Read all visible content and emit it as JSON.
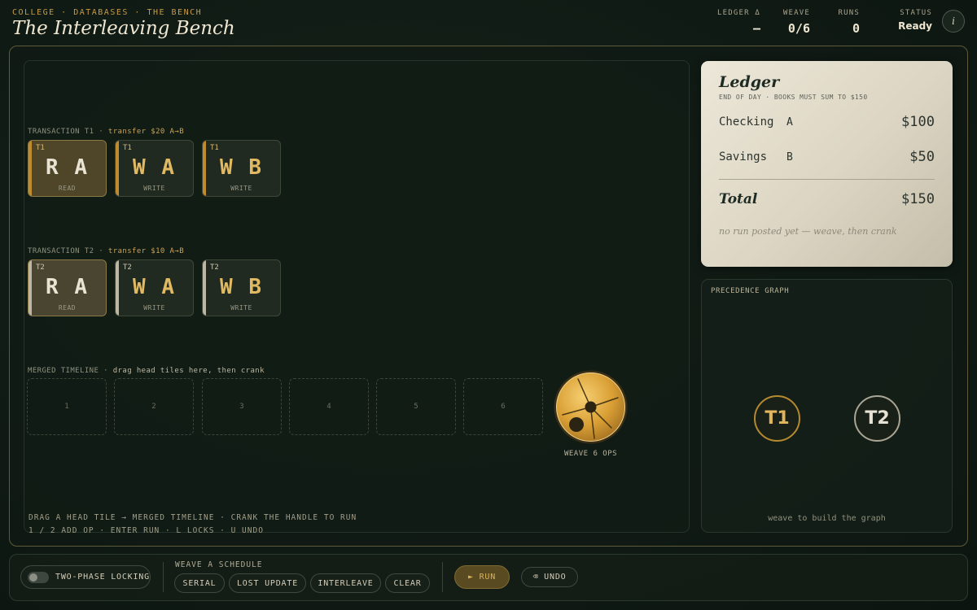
{
  "header": {
    "breadcrumb": "COLLEGE · DATABASES · THE BENCH",
    "title": "The Interleaving Bench",
    "stats": [
      {
        "label": "LEDGER Δ",
        "value": "—"
      },
      {
        "label": "WEAVE",
        "value": "0/6"
      },
      {
        "label": "RUNS",
        "value": "0"
      },
      {
        "label": "STATUS",
        "value": "Ready"
      }
    ],
    "help_icon_glyph": "i"
  },
  "bench": {
    "t1": {
      "label_prefix": "TRANSACTION T1  ·  ",
      "label_detail": "transfer $20  A→B",
      "tiles": [
        {
          "tag": "T1",
          "op": "R A",
          "kind": "READ"
        },
        {
          "tag": "T1",
          "op": "W A",
          "kind": "WRITE"
        },
        {
          "tag": "T1",
          "op": "W B",
          "kind": "WRITE"
        }
      ]
    },
    "t2": {
      "label_prefix": "TRANSACTION T2  ·  ",
      "label_detail": "transfer $10  A→B",
      "tiles": [
        {
          "tag": "T2",
          "op": "R A",
          "kind": "READ"
        },
        {
          "tag": "T2",
          "op": "W A",
          "kind": "WRITE"
        },
        {
          "tag": "T2",
          "op": "W B",
          "kind": "WRITE"
        }
      ]
    },
    "timeline": {
      "label_prefix": "MERGED TIMELINE  ·  ",
      "label_detail": "drag head tiles here, then crank",
      "slots": [
        "1",
        "2",
        "3",
        "4",
        "5",
        "6"
      ]
    },
    "crank_label": "WEAVE 6 OPS",
    "hint_line1": "DRAG A HEAD TILE → MERGED TIMELINE · CRANK THE HANDLE TO RUN",
    "hint_line2": "1 / 2 ADD OP · ENTER RUN · L LOCKS · U UNDO"
  },
  "ledger": {
    "title": "Ledger",
    "subtitle": "END OF DAY  ·  BOOKS MUST SUM TO $150",
    "rows": [
      {
        "name": "Checking",
        "key": "A",
        "amount": "$100"
      },
      {
        "name": "Savings",
        "key": "B",
        "amount": "$50"
      }
    ],
    "total_label": "Total",
    "total_amount": "$150",
    "note": "no run posted yet — weave, then crank"
  },
  "graph": {
    "title": "PRECEDENCE GRAPH",
    "nodes": [
      "T1",
      "T2"
    ],
    "footer": "weave to build the graph"
  },
  "controls": {
    "toggle_label": "TWO-PHASE LOCKING",
    "toggle_on": false,
    "weave_label": "WEAVE A SCHEDULE",
    "schedules": [
      "SERIAL",
      "LOST UPDATE",
      "INTERLEAVE",
      "CLEAR"
    ],
    "run_label": "► RUN",
    "undo_label": "⌫ UNDO"
  },
  "colors": {
    "accent": "#c79a46",
    "background": "#101a14",
    "paper": "#e6e0cf"
  }
}
